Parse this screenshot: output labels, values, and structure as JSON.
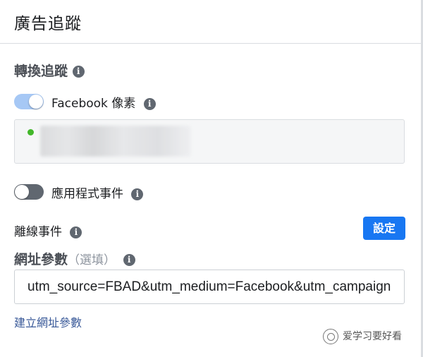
{
  "header": {
    "title": "廣告追蹤"
  },
  "conversion": {
    "title": "轉換追蹤",
    "facebook_pixel": {
      "label": "Facebook 像素",
      "enabled": true,
      "status_color": "#42b72a"
    },
    "app_events": {
      "label": "應用程式事件",
      "enabled": false
    },
    "offline_events": {
      "label": "離線事件",
      "button_label": "設定"
    }
  },
  "url_params": {
    "label": "網址參數",
    "optional_hint": "（選填）",
    "value": "utm_source=FBAD&utm_medium=Facebook&utm_campaign",
    "build_link": "建立網址參數"
  },
  "watermark": {
    "text": "爱学习要好看"
  },
  "colors": {
    "accent": "#1877f2",
    "toggle_on": "#a6c8f5",
    "toggle_off": "#606770",
    "link": "#385898"
  },
  "icons": {
    "info": "info-icon",
    "watermark": "wechat-logo-icon"
  }
}
